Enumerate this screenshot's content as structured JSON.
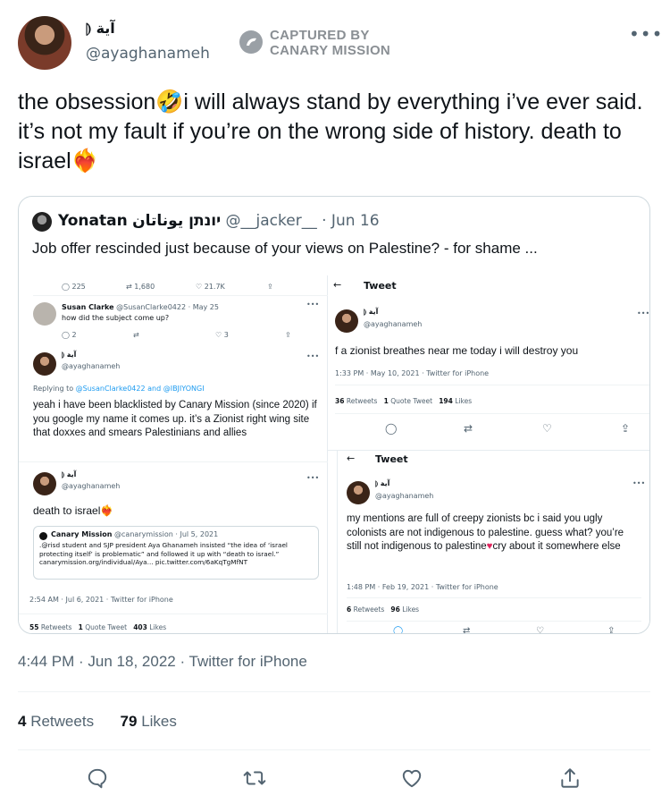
{
  "header": {
    "display_name": "آية ⦇",
    "handle": "@ayaghanameh",
    "watermark_line1": "CAPTURED BY",
    "watermark_line2": "CANARY MISSION"
  },
  "tweet": {
    "text_part1": "the obsession",
    "text_part2": "i will always stand by everything i’ve ever said. it’s not my fault if you’re on the wrong side of history. death to israel",
    "emoji1": "🤣",
    "emoji2": "❤️‍🔥",
    "timestamp": "4:44 PM · Jun 18, 2022 · Twitter for iPhone",
    "retweets_count": "4",
    "retweets_label": "Retweets",
    "likes_count": "79",
    "likes_label": "Likes"
  },
  "quote": {
    "name": "Yonatan",
    "name_hebrew": "יונתן يوناتان",
    "handle": "@__jacker__",
    "date": "· Jun 16",
    "text": "Job offer rescinded just because of your views on Palestine? - for shame ..."
  },
  "ss_left": {
    "top_stats": [
      "225",
      "1,680",
      "21.7K"
    ],
    "reply_name": "Susan Clarke",
    "reply_handle": "@SusanClarke0422 · May 25",
    "reply_text": "how did the subject come up?",
    "reply_stats": [
      "2",
      "3"
    ],
    "aya_name": "آية ⦇",
    "aya_handle": "@ayaghanameh",
    "replying_prefix": "Replying to",
    "replying_to": "@SusanClarke0422 and @IBJIYONGI",
    "blacklist_text": "yeah i have been blacklisted by Canary Mission (since 2020) if you google my name it comes up. it’s a Zionist right wing site that doxxes and smears Palestinians and allies",
    "aya2_name": "آية ⦇",
    "aya2_handle": "@ayaghanameh",
    "death_text": "death to israel",
    "inner_quote_name": "Canary Mission",
    "inner_quote_handle": "@canarymission · Jul 5, 2021",
    "inner_quote_text": ".@risd student and SJP president Aya Ghanameh insisted “the idea of ‘israel protecting itself’ is problematic” and followed it up with “death to israel.” canarymission.org/individual/Aya... pic.twitter.com/6aKqTgMfNT",
    "time": "2:54 AM · Jul 6, 2021 · Twitter for iPhone",
    "stats_retweets": "55",
    "stats_retweets_label": "Retweets",
    "stats_quotes": "1",
    "stats_quotes_label": "Quote Tweet",
    "stats_likes": "403",
    "stats_likes_label": "Likes"
  },
  "ss_right_top": {
    "back_label": "←",
    "title": "Tweet",
    "name": "آية ⦇",
    "handle": "@ayaghanameh",
    "text": "f a zionist breathes near me today i will destroy you",
    "time": "1:33 PM · May 10, 2021 · Twitter for iPhone",
    "retweets": "36",
    "retweets_label": "Retweets",
    "quotes": "1",
    "quotes_label": "Quote Tweet",
    "likes": "194",
    "likes_label": "Likes"
  },
  "ss_right_bottom": {
    "back_label": "←",
    "title": "Tweet",
    "name": "آية ⦇",
    "handle": "@ayaghanameh",
    "text1": "my mentions are full of creepy zionists bc i said you ugly colonists are not indigenous to palestine. guess what? you’re still not indigenous to palestine",
    "text2": "cry about it somewhere else",
    "time": "1:48 PM · Feb 19, 2021 · Twitter for iPhone",
    "retweets": "6",
    "retweets_label": "Retweets",
    "likes": "96",
    "likes_label": "Likes"
  },
  "colors": {
    "text": "#0f1419",
    "muted": "#536471",
    "link": "#1d9bf0",
    "border": "#cfd9de",
    "heart_red": "#e0245e"
  }
}
